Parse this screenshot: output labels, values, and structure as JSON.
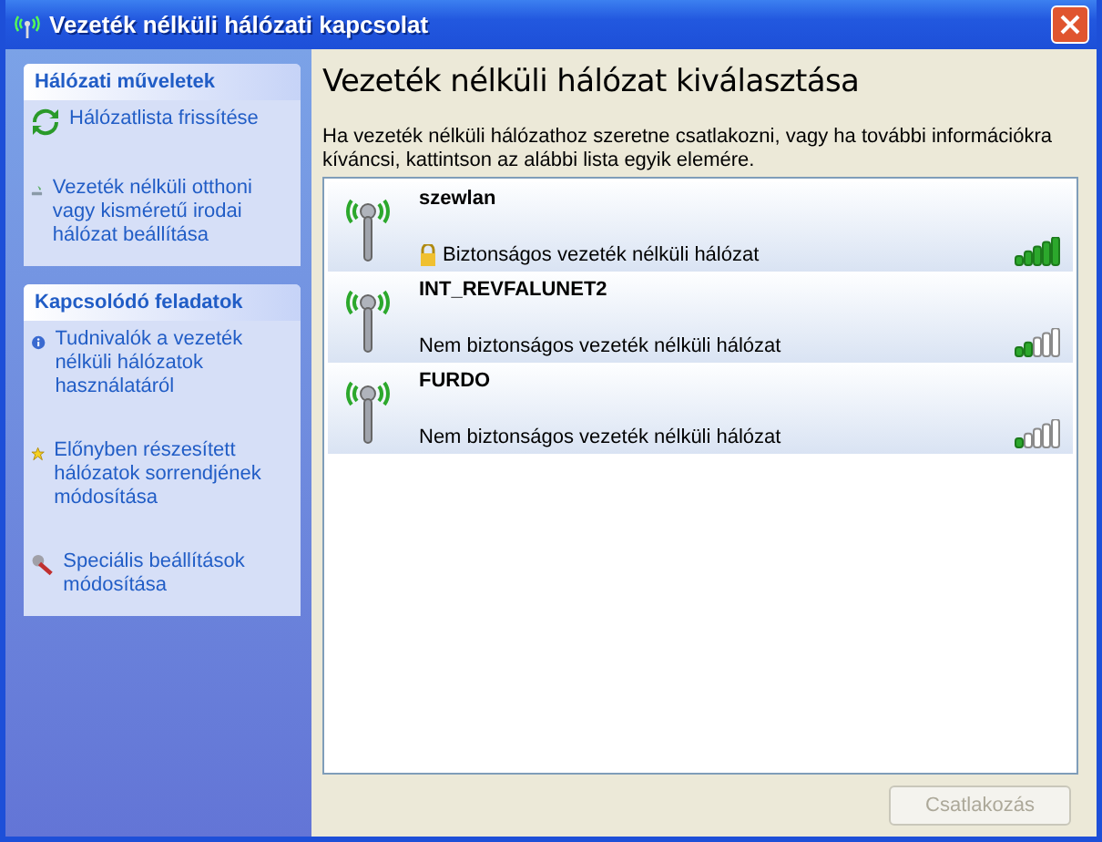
{
  "window": {
    "title": "Vezeték nélküli hálózati kapcsolat"
  },
  "sidebar": {
    "sections": [
      {
        "title": "Hálózati műveletek",
        "items": [
          {
            "label": "Hálózatlista frissítése",
            "kind": "refresh"
          },
          {
            "label": "Vezeték nélküli otthoni vagy kisméretű irodai hálózat beállítása",
            "kind": "setup"
          }
        ]
      },
      {
        "title": "Kapcsolódó feladatok",
        "items": [
          {
            "label": "Tudnivalók a vezeték nélküli hálózatok használatáról",
            "kind": "info"
          },
          {
            "label": "Előnyben részesített hálózatok sorrendjének módosítása",
            "kind": "star"
          },
          {
            "label": "Speciális beállítások módosítása",
            "kind": "tools"
          }
        ]
      }
    ]
  },
  "main": {
    "heading": "Vezeték nélküli hálózat kiválasztása",
    "description": "Ha vezeték nélküli hálózathoz szeretne csatlakozni, vagy ha további információkra kíváncsi, kattintson az alábbi lista egyik elemére.",
    "networks": [
      {
        "name": "szewlan",
        "security": "Biztonságos vezeték nélküli hálózat",
        "secured": true,
        "level": 1
      },
      {
        "name": "INT_REVFALUNET2",
        "security": "Nem biztonságos vezeték nélküli hálózat",
        "secured": false,
        "level": 0.4
      },
      {
        "name": "FURDO",
        "security": "Nem biztonságos vezeték nélküli hálózat",
        "secured": false,
        "level": 0.2
      }
    ],
    "connect_button": {
      "label": "Csatlakozás",
      "disabled": true
    }
  }
}
